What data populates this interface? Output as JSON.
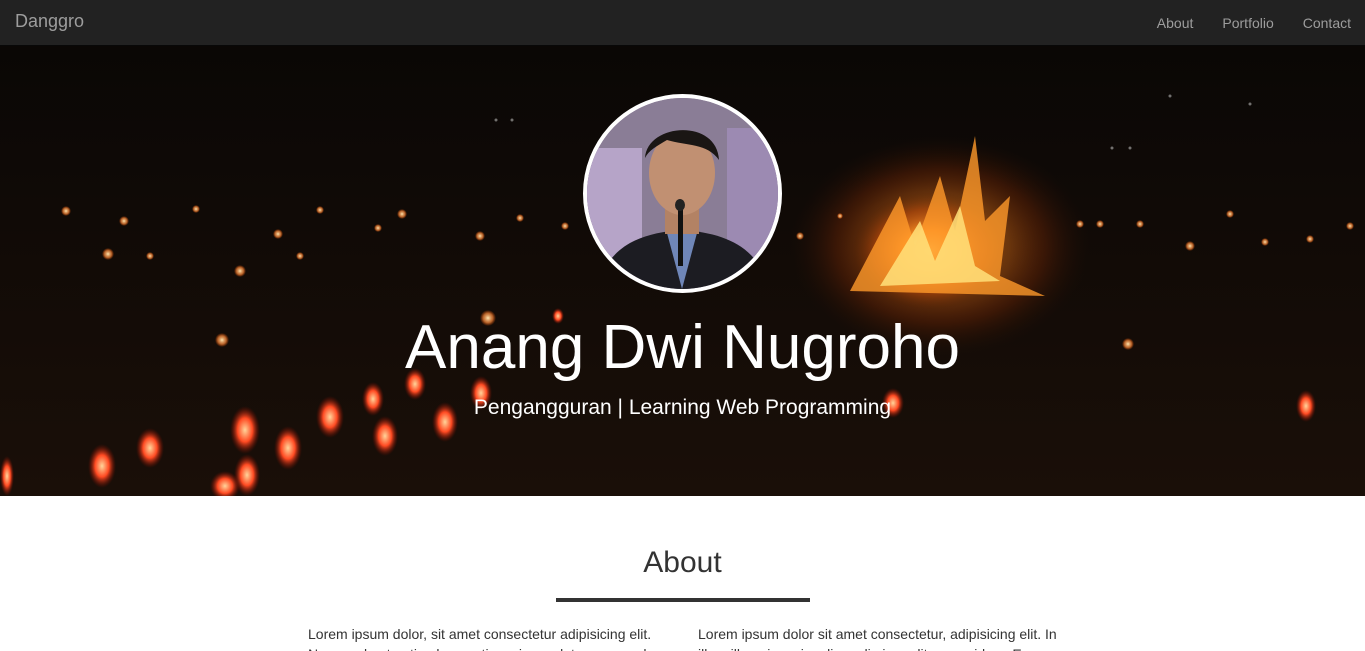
{
  "navbar": {
    "brand": "Danggro",
    "links": [
      "About",
      "Portfolio",
      "Contact"
    ]
  },
  "hero": {
    "name": "Anang Dwi Nugroho",
    "tagline": "Pengangguran | Learning Web Programming"
  },
  "about": {
    "title": "About",
    "col_left": "Lorem ipsum dolor, sit amet consectetur adipisicing elit. Nemo vel aut optio obcaecati maxime soluta accusanda",
    "col_right": "Lorem ipsum dolor sit amet consectetur, adipisicing elit. In illum illo quis, enim alias odio impedit quo quidem. Eos"
  },
  "colors": {
    "navbar_bg": "#222222",
    "nav_text": "#9d9d9d",
    "hero_bg": "#060504",
    "text": "#333333"
  }
}
